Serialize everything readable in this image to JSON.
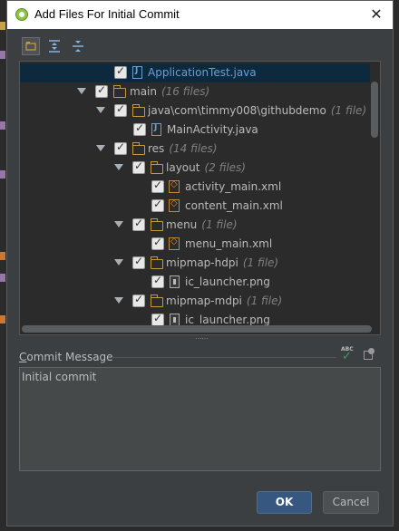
{
  "window": {
    "title": "Add Files For Initial Commit",
    "close_glyph": "✕"
  },
  "toolbar": {
    "group_icon": "group-by-directory-icon",
    "expand_icon": "expand-all-icon",
    "collapse_icon": "collapse-all-icon"
  },
  "tree": {
    "rows": [
      {
        "name": "ApplicationTest.java",
        "meta": "",
        "kind": "java",
        "selected": true
      },
      {
        "name": "main",
        "meta": "(16 files)",
        "kind": "folder"
      },
      {
        "name": "java\\com\\timmy008\\githubdemo",
        "meta": "(1 file)",
        "kind": "folder"
      },
      {
        "name": "MainActivity.java",
        "meta": "",
        "kind": "java"
      },
      {
        "name": "res",
        "meta": "(14 files)",
        "kind": "folder"
      },
      {
        "name": "layout",
        "meta": "(2 files)",
        "kind": "folder"
      },
      {
        "name": "activity_main.xml",
        "meta": "",
        "kind": "xml"
      },
      {
        "name": "content_main.xml",
        "meta": "",
        "kind": "xml"
      },
      {
        "name": "menu",
        "meta": "(1 file)",
        "kind": "folder"
      },
      {
        "name": "menu_main.xml",
        "meta": "",
        "kind": "xml"
      },
      {
        "name": "mipmap-hdpi",
        "meta": "(1 file)",
        "kind": "folder"
      },
      {
        "name": "ic_launcher.png",
        "meta": "",
        "kind": "png"
      },
      {
        "name": "mipmap-mdpi",
        "meta": "(1 file)",
        "kind": "folder"
      },
      {
        "name": "ic_launcher.png",
        "meta": "",
        "kind": "png"
      }
    ]
  },
  "commit": {
    "label_prefix": "C",
    "label_rest": "ommit Message",
    "message": "Initial commit",
    "spellcheck_text": "ABC"
  },
  "buttons": {
    "ok": "OK",
    "cancel": "Cancel"
  },
  "colors": {
    "accent": "#365880",
    "selection": "#0d293e",
    "java": "#6a9fd4",
    "folder": "#c49a3b",
    "spell_ok": "#3fa24c"
  }
}
